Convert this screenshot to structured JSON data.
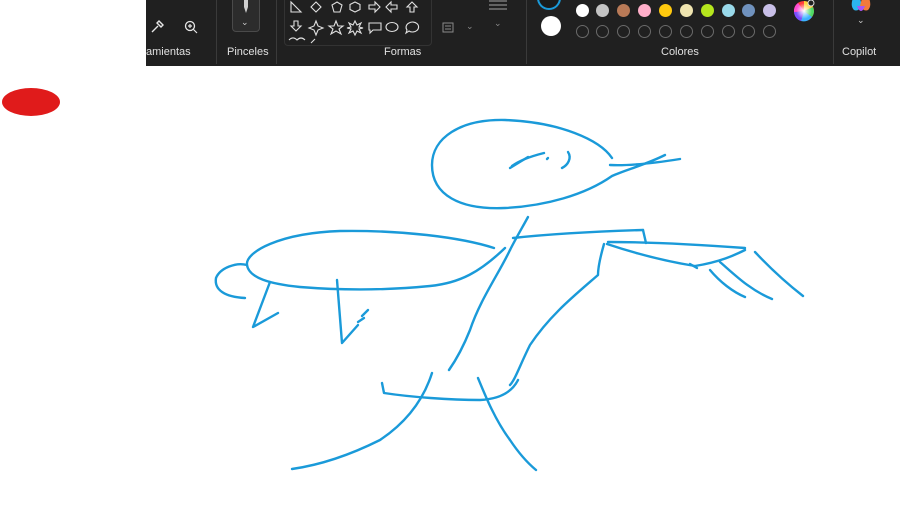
{
  "ribbon": {
    "groups": {
      "tools_label": "amientas",
      "brushes_label": "Pinceles",
      "shapes_label": "Formas",
      "colors_label": "Colores",
      "copilot_label": "Copilot"
    }
  },
  "colors": {
    "primary": "#1a1a1a",
    "secondary": "#ffffff",
    "palette_row1": [
      "#ffffff",
      "#c3c3c3",
      "#b97a57",
      "#ffaec9",
      "#ffc90e",
      "#efe4b0",
      "#b5e61d",
      "#99d9ea",
      "#7092be",
      "#c8bfe7"
    ],
    "empty_slots": 10
  },
  "canvas": {
    "stroke_color": "#1a9ad9",
    "blob_color": "#e01b1b"
  },
  "icons": {
    "eyedropper": "eyedropper-icon",
    "zoom": "zoom-icon",
    "brush": "brush-icon",
    "color_picker": "color-wheel-icon",
    "copilot": "copilot-icon"
  }
}
